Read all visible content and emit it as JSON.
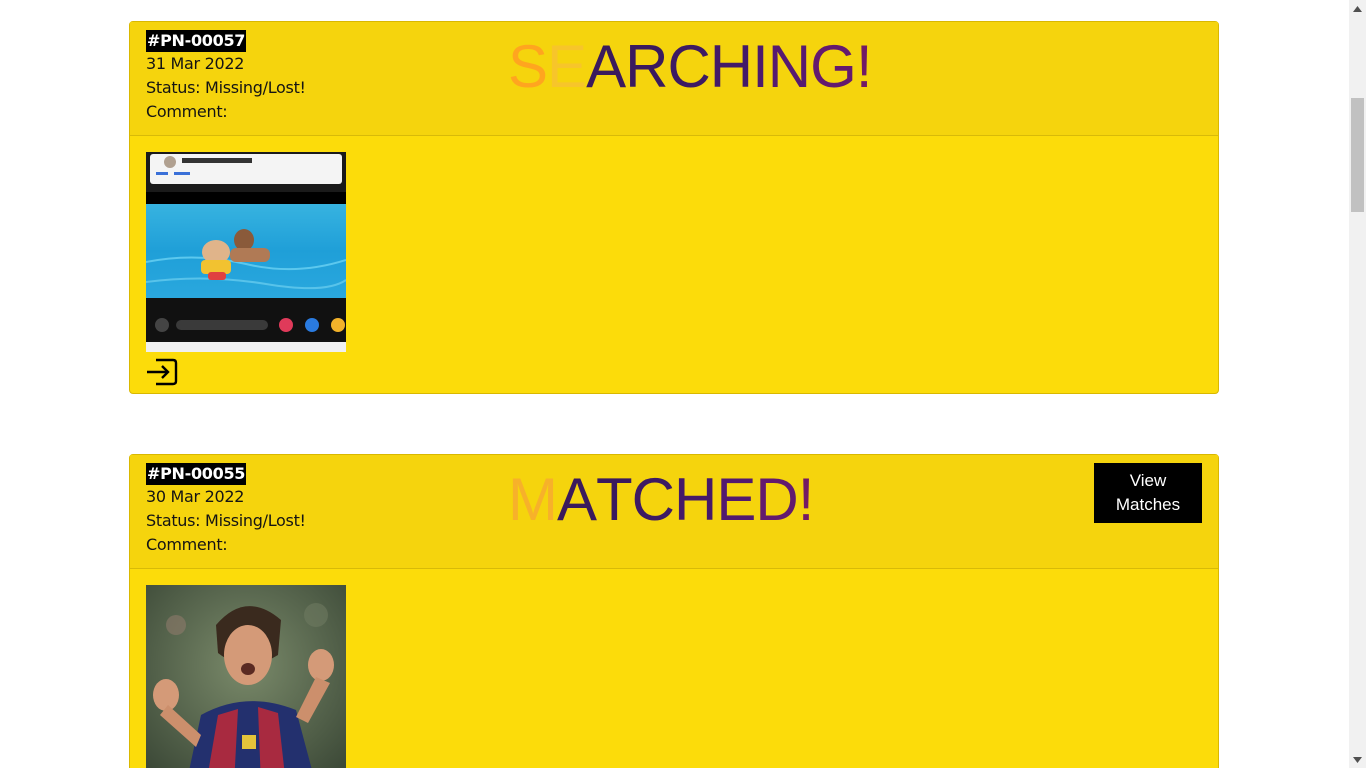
{
  "cards": [
    {
      "id": "#PN-00057",
      "date": "31 Mar 2022",
      "status": "Status: Missing/Lost!",
      "comment": "Comment:",
      "headline": "SEARCHING!",
      "headline_colors": [
        "#ffa51f",
        "#f7c52a",
        "#3b1a5c",
        "#3a1a5e",
        "#3d1a63",
        "#431a68",
        "#4b1a6d",
        "#561a70",
        "#641a6e",
        "#711a66"
      ],
      "has_view_button": false,
      "photo": "child-swimming-screenshot"
    },
    {
      "id": "#PN-00055",
      "date": "30 Mar 2022",
      "status": "Status: Missing/Lost!",
      "comment": "Comment:",
      "headline": "MATCHED!",
      "headline_colors": [
        "#f7b12a",
        "#3b1a5c",
        "#3a1a5e",
        "#3d1a63",
        "#451a69",
        "#521a6f",
        "#621a6e",
        "#741a64"
      ],
      "has_view_button": true,
      "view_button": {
        "line1": "View",
        "line2": "Matches"
      },
      "photo": "football-player-celebrating"
    }
  ],
  "icons": {
    "exit": "exit-to-icon",
    "scroll_up": "scroll-up-arrow-icon",
    "scroll_down": "scroll-down-arrow-icon"
  },
  "colors": {
    "card_bg": "#fcdc0a",
    "header_bg": "#f5d40d",
    "badge_bg": "#000000"
  }
}
